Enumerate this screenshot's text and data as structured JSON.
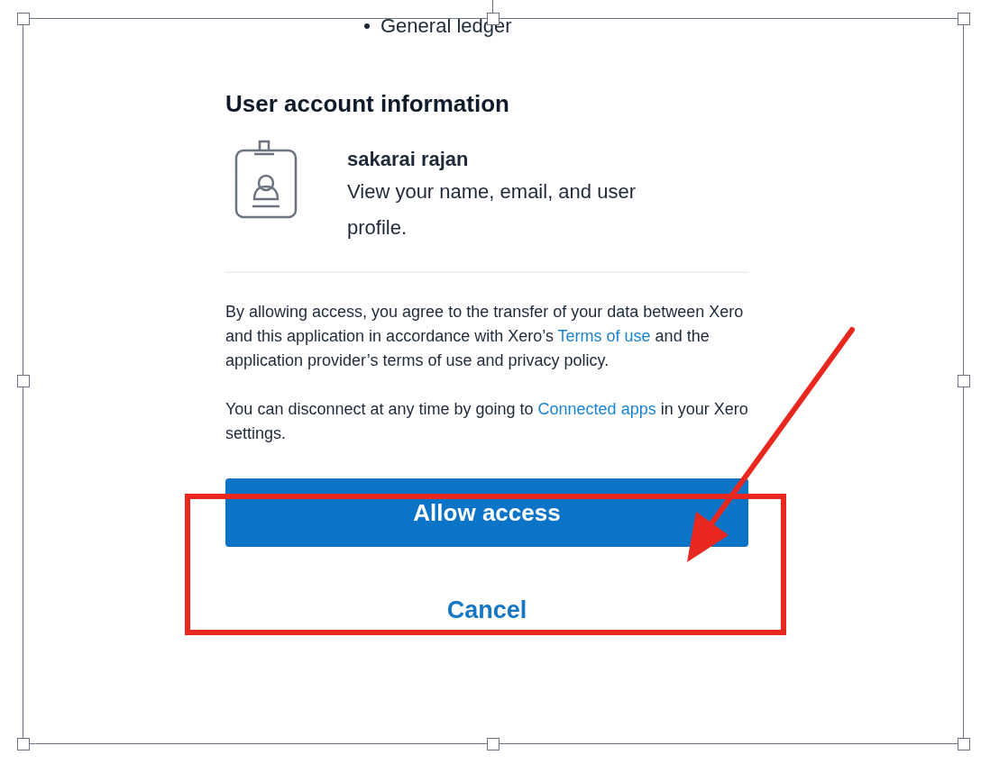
{
  "bullet_items": [
    "General ledger"
  ],
  "section": {
    "title": "User account information",
    "user_name": "sakarai rajan",
    "description": "View your name, email, and user profile."
  },
  "paragraphs": [
    {
      "segments": [
        {
          "kind": "text",
          "text": "By allowing access, you agree to the transfer of your data between Xero and this application in accordance with Xero’s "
        },
        {
          "kind": "link",
          "text": "Terms of use"
        },
        {
          "kind": "text",
          "text": " and the application provider’s terms of use and privacy policy."
        }
      ]
    },
    {
      "segments": [
        {
          "kind": "text",
          "text": "You can disconnect at any time by going to "
        },
        {
          "kind": "link",
          "text": "Connected apps"
        },
        {
          "kind": "text",
          "text": " in your Xero settings."
        }
      ]
    }
  ],
  "primary_button": "Allow access",
  "cancel_link": "Cancel"
}
